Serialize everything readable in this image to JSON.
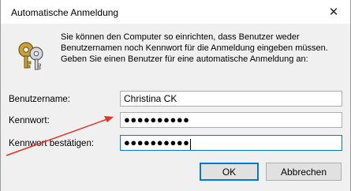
{
  "window": {
    "title": "Automatische Anmeldung",
    "close_glyph": "✕"
  },
  "info": {
    "icon": "keys-icon",
    "message_lines": [
      "Sie können den Computer so einrichten, dass Benutzer weder",
      "Benutzernamen noch Kennwort für die Anmeldung eingeben müssen.",
      "Geben Sie einen Benutzer für eine automatische Anmeldung an:"
    ]
  },
  "form": {
    "username_label": "Benutzername:",
    "username_value": "Christina CK",
    "password_label": "Kennwort:",
    "password_value": "●●●●●●●●●●",
    "confirm_label": "Kennwort bestätigen:",
    "confirm_value": "●●●●●●●●●●"
  },
  "buttons": {
    "ok_label": "OK",
    "cancel_label": "Abbrechen"
  },
  "annotation": {
    "arrow_color": "#e8321e"
  }
}
